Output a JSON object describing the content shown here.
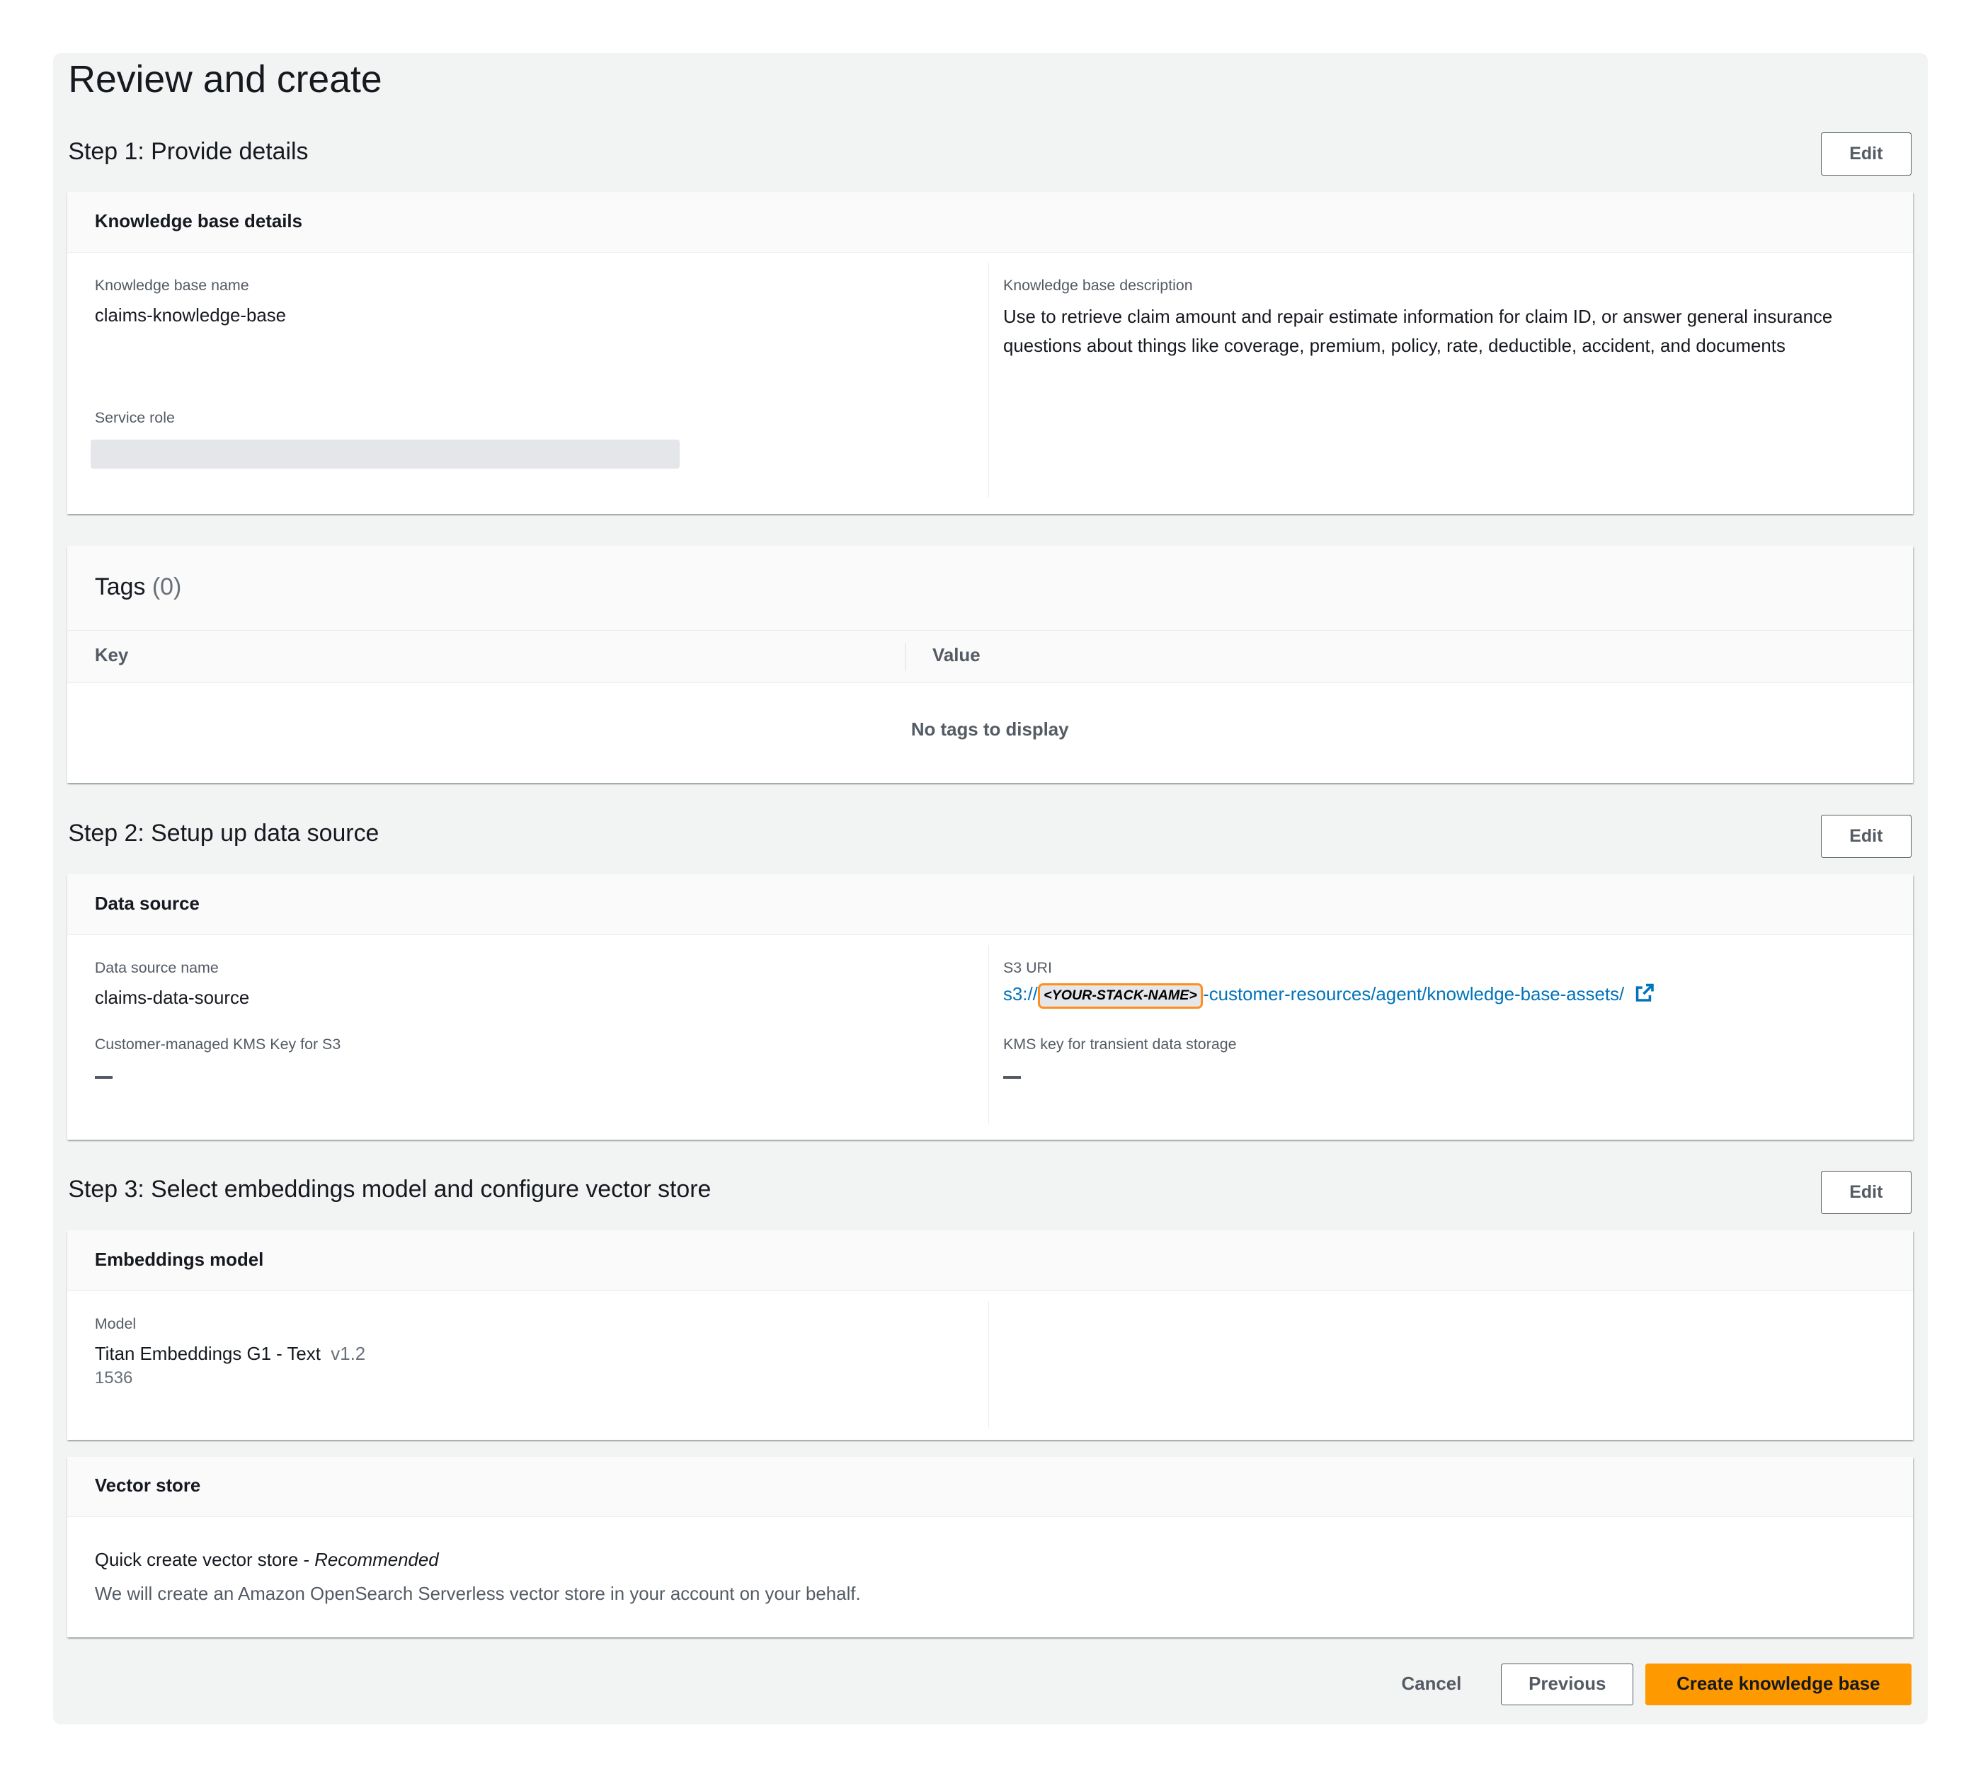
{
  "page_title": "Review and create",
  "edit_label": "Edit",
  "step1": {
    "heading": "Step 1: Provide details",
    "kb_details": {
      "title": "Knowledge base details",
      "name_label": "Knowledge base name",
      "name_value": "claims-knowledge-base",
      "service_role_label": "Service role",
      "description_label": "Knowledge base description",
      "description_value": "Use to retrieve claim amount and repair estimate information for claim ID, or answer general insurance questions about things like coverage, premium, policy, rate, deductible, accident, and documents"
    },
    "tags": {
      "title": "Tags",
      "count": "(0)",
      "columns": [
        "Key",
        "Value"
      ],
      "empty_text": "No tags to display"
    }
  },
  "step2": {
    "heading": "Step 2: Setup up data source",
    "data_source": {
      "title": "Data source",
      "name_label": "Data source name",
      "name_value": "claims-data-source",
      "kms_s3_label": "Customer-managed KMS Key for S3",
      "kms_s3_value": "—",
      "s3_uri_label": "S3 URI",
      "s3_prefix": "s3://",
      "s3_placeholder": "<YOUR-STACK-NAME>",
      "s3_suffix": "-customer-resources/agent/knowledge-base-assets/",
      "kms_transient_label": "KMS key for transient data storage",
      "kms_transient_value": "—"
    }
  },
  "step3": {
    "heading": "Step 3: Select embeddings model and configure vector store",
    "embeddings": {
      "title": "Embeddings model",
      "model_label": "Model",
      "model_name": "Titan Embeddings G1 - Text",
      "model_version": "v1.2",
      "dimensions": "1536"
    },
    "vector_store": {
      "title": "Vector store",
      "option": "Quick create vector store - ",
      "option_tag": "Recommended",
      "description": "We will create an Amazon OpenSearch Serverless vector store in your account on your behalf."
    }
  },
  "footer": {
    "cancel": "Cancel",
    "previous": "Previous",
    "create": "Create knowledge base"
  },
  "colors": {
    "primary": "#ec7211",
    "link": "#0073bb",
    "highlight": "#ff8f1c"
  }
}
